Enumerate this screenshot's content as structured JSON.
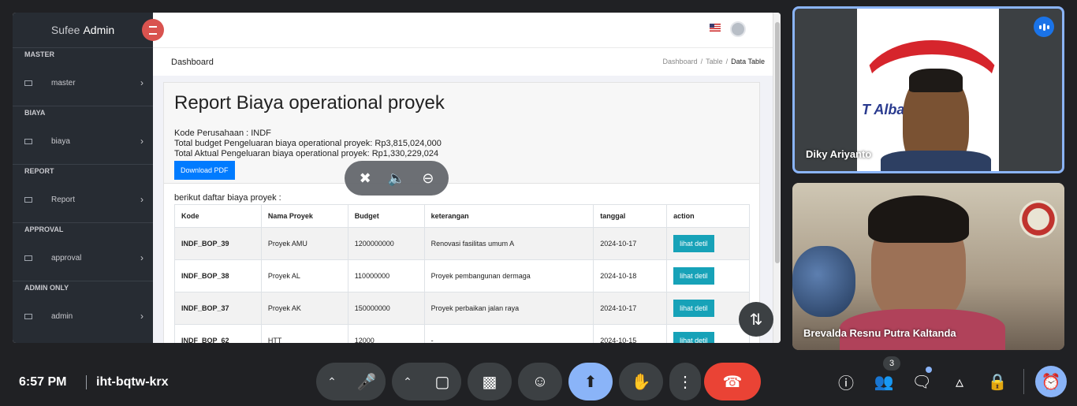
{
  "shared_screen": {
    "brand_prefix": "Sufee",
    "brand_bold": "Admin",
    "sidebar": [
      {
        "section": "MASTER",
        "item": "master"
      },
      {
        "section": "BIAYA",
        "item": "biaya"
      },
      {
        "section": "REPORT",
        "item": "Report"
      },
      {
        "section": "APPROVAL",
        "item": "approval"
      },
      {
        "section": "ADMIN ONLY",
        "item": "admin"
      }
    ],
    "page_title": "Dashboard",
    "breadcrumb": [
      "Dashboard",
      "Table",
      "Data Table"
    ],
    "report": {
      "title": "Report Biaya operational proyek",
      "kode_perusahaan": "Kode Perusahaan : INDF",
      "total_budget": "Total budget Pengeluaran biaya operational proyek: Rp3,815,024,000",
      "total_aktual": "Total Aktual Pengeluaran biaya operational proyek: Rp1,330,229,024",
      "download_label": "Download PDF",
      "list_lead": "berikut daftar biaya proyek :",
      "columns": [
        "Kode",
        "Nama Proyek",
        "Budget",
        "keterangan",
        "tanggal",
        "action"
      ],
      "action_label": "lihat detil",
      "rows": [
        {
          "kode": "INDF_BOP_39",
          "nama": "Proyek AMU",
          "budget": "1200000000",
          "keterangan": "Renovasi fasilitas umum A",
          "tanggal": "2024-10-17"
        },
        {
          "kode": "INDF_BOP_38",
          "nama": "Proyek AL",
          "budget": "110000000",
          "keterangan": "Proyek pembangunan dermaga",
          "tanggal": "2024-10-18"
        },
        {
          "kode": "INDF_BOP_37",
          "nama": "Proyek AK",
          "budget": "150000000",
          "keterangan": "Proyek perbaikan jalan raya",
          "tanggal": "2024-10-17"
        },
        {
          "kode": "INDF_BOP_62",
          "nama": "HTT",
          "budget": "12000",
          "keterangan": "-",
          "tanggal": "2024-10-15"
        }
      ]
    }
  },
  "overlay_icons": [
    "unpin-icon",
    "volume-icon",
    "minus-circle-icon"
  ],
  "participants": [
    {
      "name": "Diky Ariyanto",
      "speaking": true,
      "background_logo_text": "T Albar        estar"
    },
    {
      "name": "Brevalda Resnu Putra Kaltanda"
    }
  ],
  "meeting": {
    "time": "6:57 PM",
    "code": "iht-bqtw-krx",
    "participant_count": "3"
  },
  "colors": {
    "accent": "#8ab4f8",
    "end_call": "#ea4335",
    "control_bg": "#3c4043",
    "pdf_button": "#007bff",
    "detail_button": "#17a2b8"
  }
}
